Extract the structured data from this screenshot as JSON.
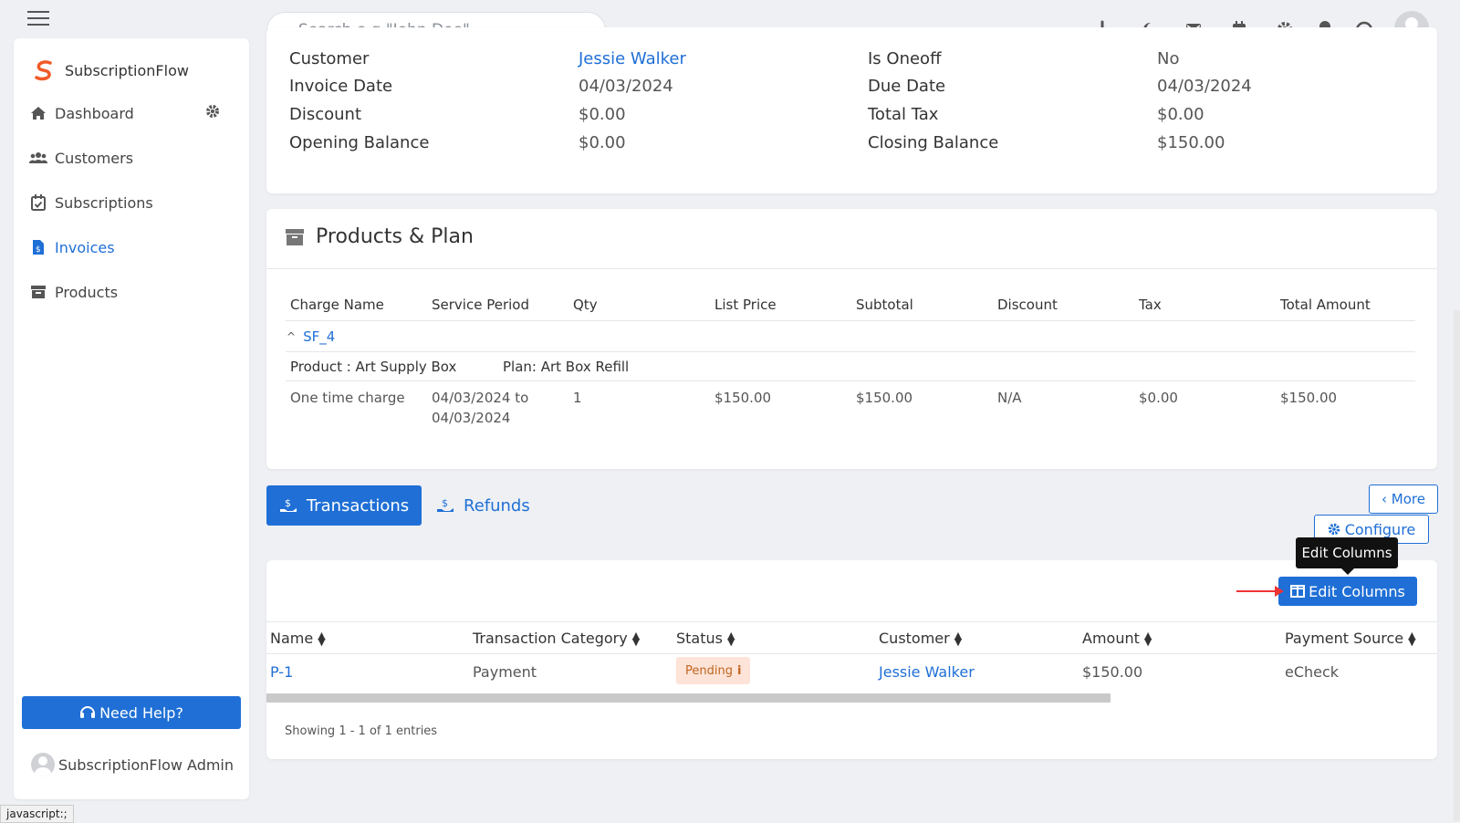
{
  "topbar": {
    "search_placeholder": "Search e.g \"John Doe\"",
    "icons": [
      "plus-icon",
      "moon-icon",
      "mail-icon",
      "calendar-icon",
      "gear-icon",
      "bell-icon",
      "headset-icon",
      "avatar"
    ]
  },
  "sidebar": {
    "brand": "SubscriptionFlow",
    "items": [
      {
        "label": "Dashboard",
        "icon": "home-icon",
        "active": false
      },
      {
        "label": "Customers",
        "icon": "users-icon",
        "active": false
      },
      {
        "label": "Subscriptions",
        "icon": "calendar-check-icon",
        "active": false
      },
      {
        "label": "Invoices",
        "icon": "invoice-icon",
        "active": true
      },
      {
        "label": "Products",
        "icon": "archive-icon",
        "active": false
      }
    ],
    "help_label": "Need Help?",
    "admin_name": "SubscriptionFlow Admin"
  },
  "invoice_info": {
    "cut_row": {
      "left_label": "Customer",
      "left_value": "Jessie Walker",
      "right_label": "Is Oneoff",
      "right_value": "No"
    },
    "rows": [
      {
        "left_label": "Invoice Date",
        "left_value": "04/03/2024",
        "right_label": "Due Date",
        "right_value": "04/03/2024"
      },
      {
        "left_label": "Discount",
        "left_value": "$0.00",
        "right_label": "Total Tax",
        "right_value": "$0.00"
      },
      {
        "left_label": "Opening Balance",
        "left_value": "$0.00",
        "right_label": "Closing Balance",
        "right_value": "$150.00"
      }
    ]
  },
  "products": {
    "title": "Products & Plan",
    "headers": [
      "Charge Name",
      "Service Period",
      "Qty",
      "List Price",
      "Subtotal",
      "Discount",
      "Tax",
      "Total Amount"
    ],
    "group": "SF_4",
    "product_label": "Product : Art Supply Box",
    "plan_label": "Plan: Art Box Refill",
    "row": {
      "charge_name": "One time charge",
      "service_period_1": "04/03/2024 to",
      "service_period_2": "04/03/2024",
      "qty": "1",
      "list_price": "$150.00",
      "subtotal": "$150.00",
      "discount": "N/A",
      "tax": "$0.00",
      "total": "$150.00"
    }
  },
  "tabs": {
    "transactions": "Transactions",
    "refunds": "Refunds",
    "more": "‹ More",
    "configure": "Configure"
  },
  "transactions": {
    "edit_columns": "Edit Columns",
    "tooltip": "Edit Columns",
    "headers": [
      "Name",
      "Transaction Category",
      "Status",
      "Customer",
      "Amount",
      "Payment Source"
    ],
    "row": {
      "name": "P-1",
      "category": "Payment",
      "status": "Pending",
      "customer": "Jessie Walker",
      "amount": "$150.00",
      "source": "eCheck"
    },
    "showing": "Showing 1 - 1 of 1 entries"
  },
  "statusbar": "javascript:;",
  "colors": {
    "accent": "#1f6fd6",
    "pending_bg": "#fde3d8",
    "pending_text": "#c0661f",
    "arrow": "#ee3333"
  }
}
